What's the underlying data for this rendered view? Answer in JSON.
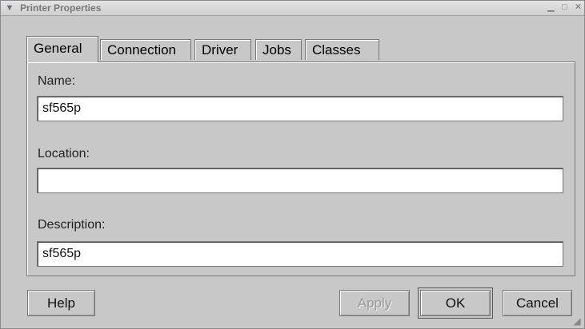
{
  "window": {
    "title": "Printer Properties",
    "menu_icon": "chevron-down-icon",
    "minimize_glyph": "▁",
    "maximize_glyph": "□",
    "close_glyph": "✕"
  },
  "tabs": [
    {
      "label": "General",
      "active": true
    },
    {
      "label": "Connection",
      "active": false
    },
    {
      "label": "Driver",
      "active": false
    },
    {
      "label": "Jobs",
      "active": false
    },
    {
      "label": "Classes",
      "active": false
    }
  ],
  "form": {
    "name_label": "Name:",
    "name_value": "sf565p",
    "location_label": "Location:",
    "location_value": "",
    "description_label": "Description:",
    "description_value": "sf565p"
  },
  "buttons": {
    "help": "Help",
    "apply": "Apply",
    "ok": "OK",
    "cancel": "Cancel"
  }
}
